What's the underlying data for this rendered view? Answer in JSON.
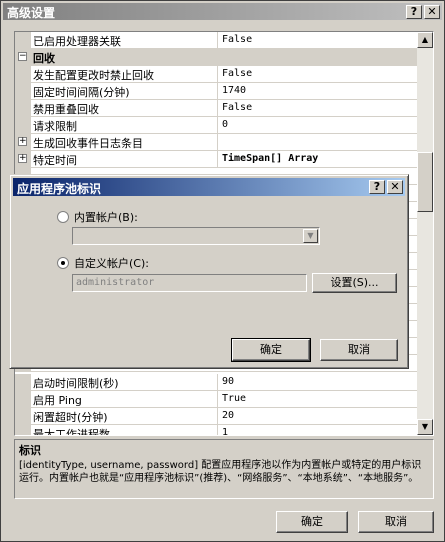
{
  "window": {
    "title": "高级设置",
    "help_glyph": "?",
    "close_glyph": "✕"
  },
  "grid": {
    "rows": [
      {
        "kind": "prop",
        "name": "已启用处理器关联",
        "value": "False"
      },
      {
        "kind": "cat",
        "name": "回收",
        "toggle": "−"
      },
      {
        "kind": "prop",
        "name": "发生配置更改时禁止回收",
        "value": "False"
      },
      {
        "kind": "prop",
        "name": "固定时间间隔(分钟)",
        "value": "1740"
      },
      {
        "kind": "prop",
        "name": "禁用重叠回收",
        "value": "False"
      },
      {
        "kind": "prop",
        "name": "请求限制",
        "value": "0"
      },
      {
        "kind": "sub",
        "name": "生成回收事件日志条目",
        "value": "",
        "toggle": "+"
      },
      {
        "kind": "sub",
        "name": "特定时间",
        "value": "TimeSpan[] Array",
        "toggle": "+"
      },
      {
        "kind": "prop",
        "name": "启动时间限制(秒)",
        "value": "90"
      },
      {
        "kind": "prop",
        "name": "启用 Ping",
        "value": "True"
      },
      {
        "kind": "prop",
        "name": "闲置超时(分钟)",
        "value": "20"
      },
      {
        "kind": "prop",
        "name": "最大工作进程数",
        "value": "1"
      }
    ],
    "scroll_up": "▲",
    "scroll_down": "▼"
  },
  "description": {
    "title": "标识",
    "body": "[identityType, username, password] 配置应用程序池以作为内置帐户或特定的用户标识运行。内置帐户也就是“应用程序池标识”(推荐)、“网络服务”、“本地系统”、“本地服务”。"
  },
  "main_buttons": {
    "ok": "确定",
    "cancel": "取消"
  },
  "dialog": {
    "title": "应用程序池标识",
    "help_glyph": "?",
    "close_glyph": "✕",
    "builtin_label": "内置帐户(B):",
    "builtin_selected": false,
    "combo_arrow": "▼",
    "custom_label": "自定义帐户(C):",
    "custom_selected": true,
    "custom_value": "administrator",
    "settings_button": "设置(S)...",
    "ok": "确定",
    "cancel": "取消"
  }
}
